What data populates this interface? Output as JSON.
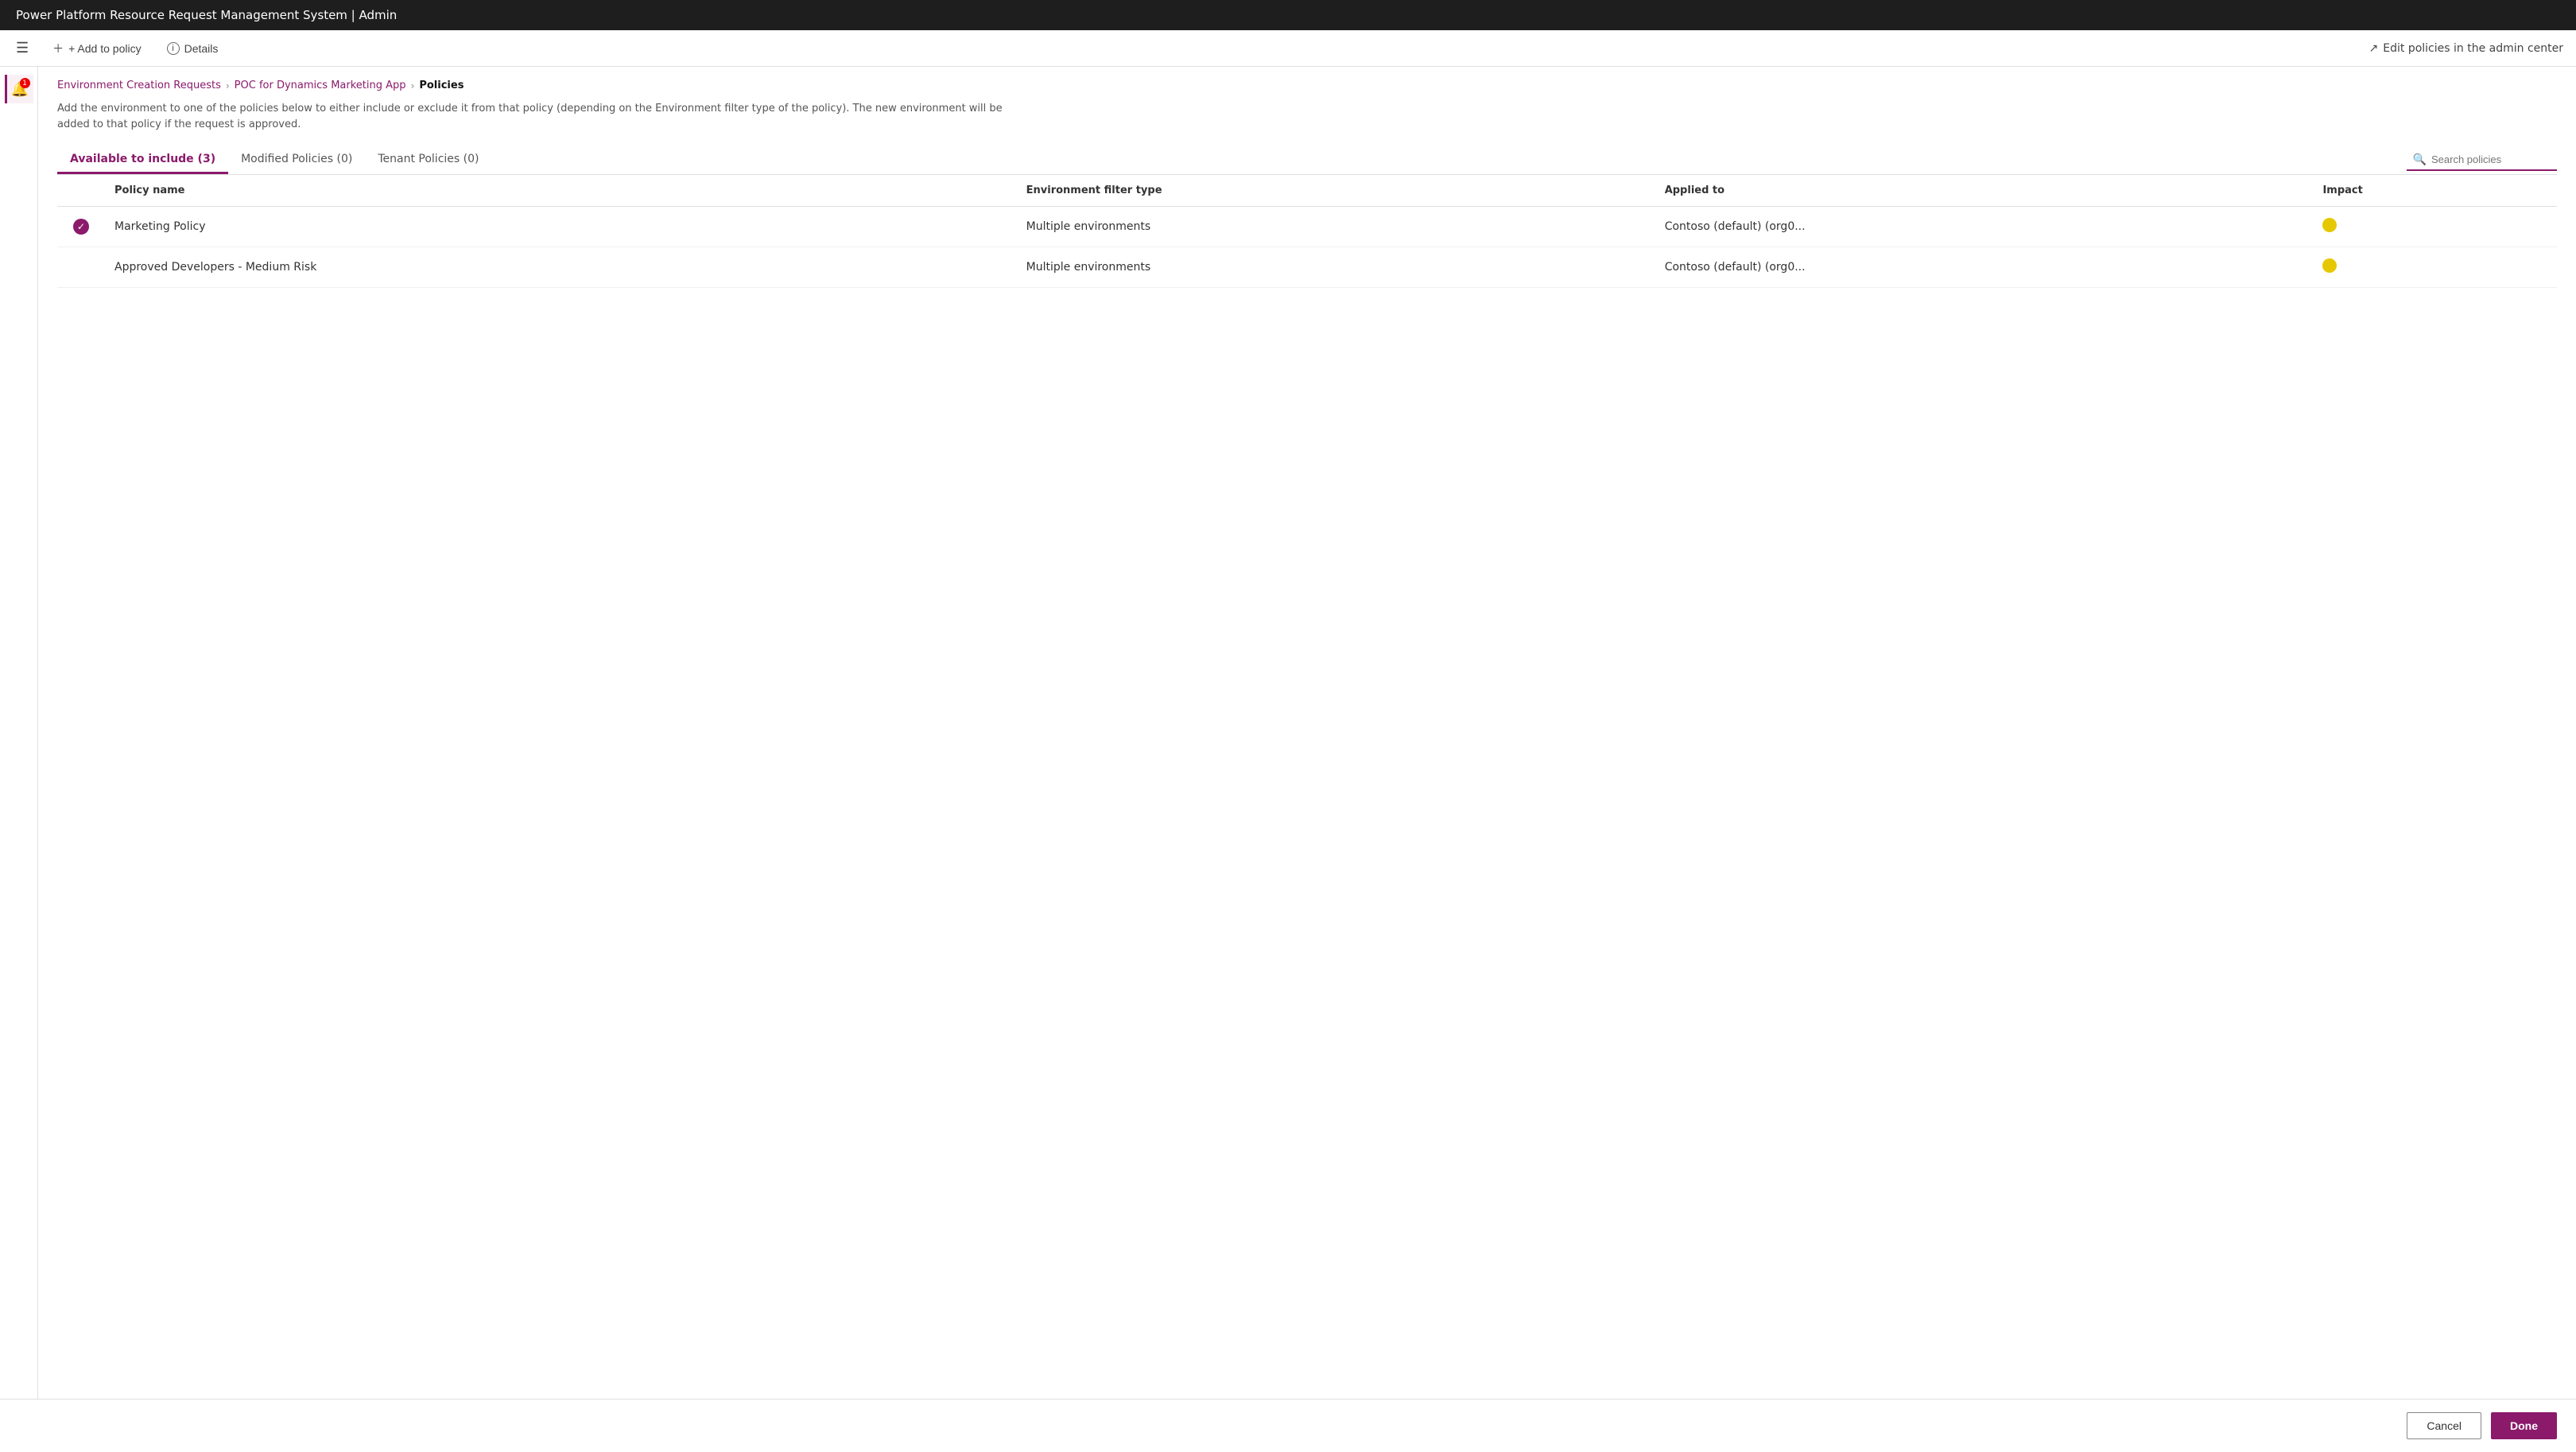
{
  "titleBar": {
    "text": "Power Platform Resource Request Management System | Admin"
  },
  "toolbar": {
    "menuIcon": "☰",
    "addToPolicy": "+ Add to policy",
    "details": "Details",
    "editPolicies": "Edit policies in the admin center"
  },
  "breadcrumb": {
    "items": [
      {
        "label": "Environment Creation Requests",
        "active": false
      },
      {
        "label": "POC for Dynamics Marketing App",
        "active": false
      },
      {
        "label": "Policies",
        "active": true
      }
    ]
  },
  "description": "Add the environment to one of the policies below to either include or exclude it from that policy (depending on the Environment filter type of the policy). The new environment will be added to that policy if the request is approved.",
  "tabs": [
    {
      "label": "Available to include (3)",
      "active": true
    },
    {
      "label": "Modified Policies (0)",
      "active": false
    },
    {
      "label": "Tenant Policies (0)",
      "active": false
    }
  ],
  "search": {
    "placeholder": "Search policies"
  },
  "table": {
    "columns": [
      {
        "label": ""
      },
      {
        "label": "Policy name"
      },
      {
        "label": "Environment filter type"
      },
      {
        "label": "Applied to"
      },
      {
        "label": "Impact"
      }
    ],
    "rows": [
      {
        "selected": true,
        "policyName": "Marketing Policy",
        "envFilterType": "Multiple environments",
        "appliedTo": "Contoso (default) (org0...",
        "impactColor": "#e6c800"
      },
      {
        "selected": false,
        "policyName": "Approved Developers - Medium Risk",
        "envFilterType": "Multiple environments",
        "appliedTo": "Contoso (default) (org0...",
        "impactColor": "#e6c800"
      }
    ]
  },
  "footer": {
    "cancelLabel": "Cancel",
    "doneLabel": "Done"
  },
  "sidebar": {
    "iconLabel": "requests",
    "badge": "1"
  }
}
